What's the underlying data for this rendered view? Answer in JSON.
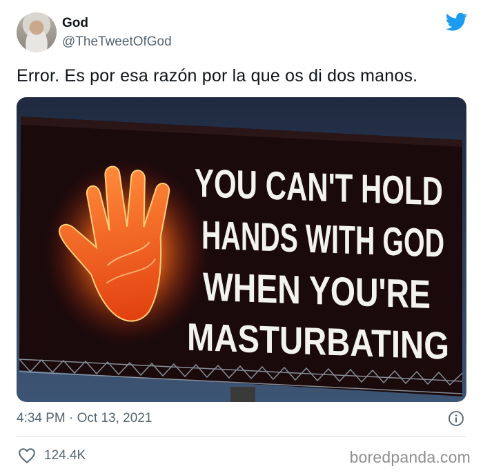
{
  "author": {
    "name": "God",
    "handle": "@TheTweetOfGod"
  },
  "tweet": {
    "text": "Error. Es por esa razón por la que os di dos manos.",
    "timestamp": "4:34 PM · Oct 13, 2021",
    "likes": "124.4K"
  },
  "billboard": {
    "lines": [
      "YOU CAN'T HOLD",
      "HANDS WITH GOD",
      "WHEN YOU'RE",
      "MASTURBATING"
    ]
  },
  "watermark": "boredpanda.com",
  "colors": {
    "twitter_blue": "#1d9bf0",
    "secondary_text": "#536471",
    "billboard_bg": "#1a0a0c",
    "flame_orange": "#ff6a1a"
  },
  "icons": {
    "brand": "twitter-bird-icon",
    "info": "info-icon",
    "like": "heart-icon"
  }
}
